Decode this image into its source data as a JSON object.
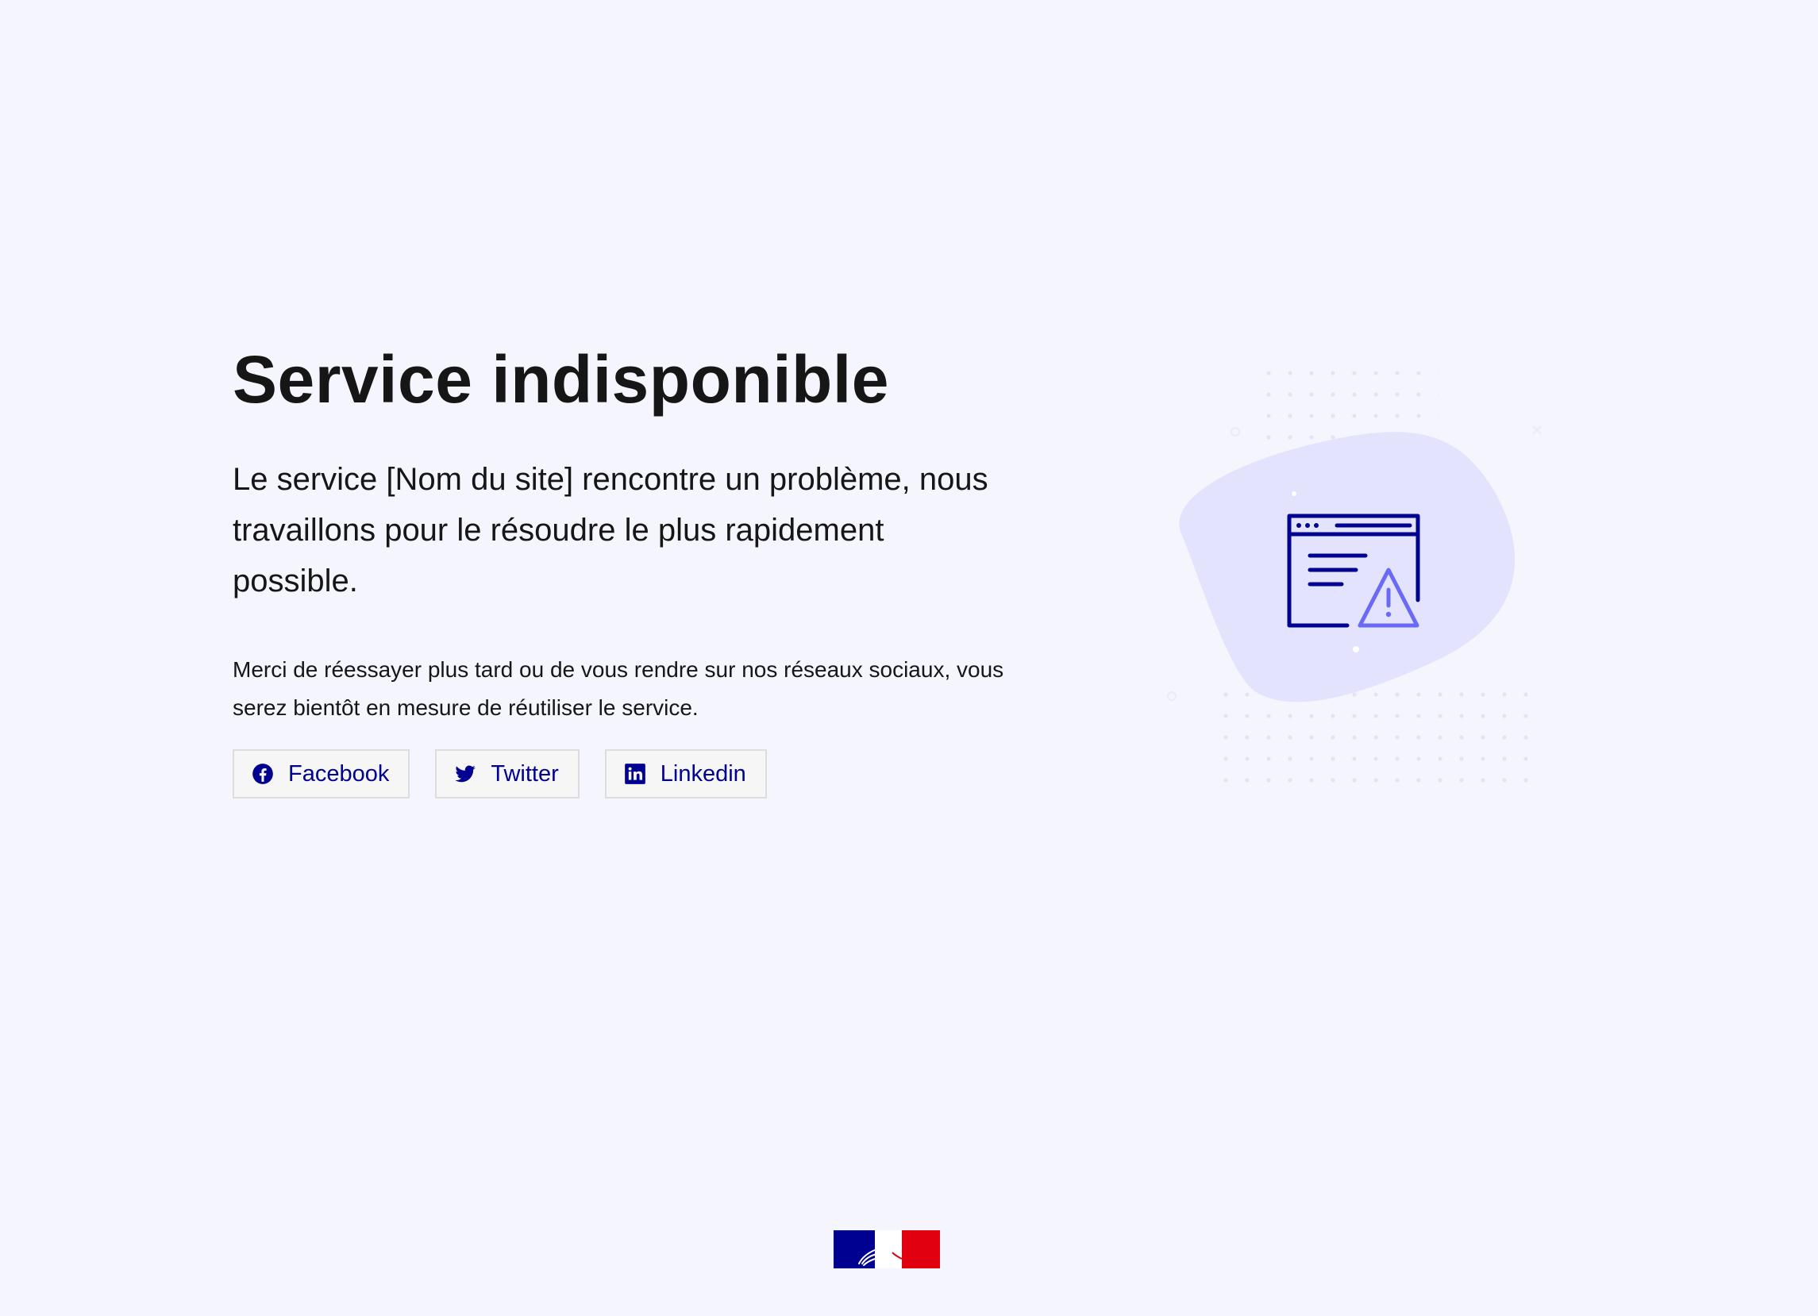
{
  "page": {
    "title": "Service indisponible",
    "lead": "Le service [Nom du site] rencontre un problème, nous travaillons pour le résoudre le plus rapidement possible.",
    "body": "Merci de réessayer plus tard ou de vous rendre sur nos réseaux sociaux, vous serez bientôt en mesure de réutiliser le service."
  },
  "social": [
    {
      "label": "Facebook",
      "icon": "facebook-icon"
    },
    {
      "label": "Twitter",
      "icon": "twitter-icon"
    },
    {
      "label": "Linkedin",
      "icon": "linkedin-icon"
    }
  ],
  "illustration": {
    "icon": "browser-warning-icon"
  },
  "footer": {
    "logo": "republique-francaise-logo"
  },
  "colors": {
    "background": "#f5f5fe",
    "primary": "#000091",
    "blob": "#e3e3fd",
    "accent": "#6a6af4",
    "flag_red": "#e1000f"
  }
}
